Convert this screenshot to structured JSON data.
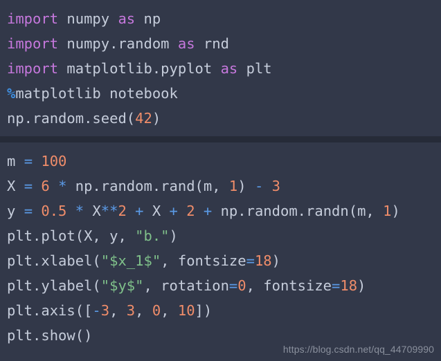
{
  "editor": {
    "theme_name": "dark-notebook",
    "background_color": "#323849",
    "separator_color": "#262b38",
    "default_text_color": "#c6cddb",
    "token_colors": {
      "keyword": "#c678dd",
      "number": "#f08d6a",
      "operator": "#5b9ae6",
      "string": "#7fc08a",
      "magic": "#3f8fe0",
      "name": "#c6cddb"
    }
  },
  "cells": [
    {
      "id": "cell-1",
      "lines": [
        {
          "id": "c1-l1",
          "text": "import numpy as np",
          "tokens": [
            {
              "t": "import",
              "c": "kw"
            },
            {
              "t": " ",
              "c": "punc"
            },
            {
              "t": "numpy",
              "c": "name"
            },
            {
              "t": " ",
              "c": "punc"
            },
            {
              "t": "as",
              "c": "kw"
            },
            {
              "t": " ",
              "c": "punc"
            },
            {
              "t": "np",
              "c": "name"
            }
          ]
        },
        {
          "id": "c1-l2",
          "text": "import numpy.random as rnd",
          "tokens": [
            {
              "t": "import",
              "c": "kw"
            },
            {
              "t": " ",
              "c": "punc"
            },
            {
              "t": "numpy.random",
              "c": "name"
            },
            {
              "t": " ",
              "c": "punc"
            },
            {
              "t": "as",
              "c": "kw"
            },
            {
              "t": " ",
              "c": "punc"
            },
            {
              "t": "rnd",
              "c": "name"
            }
          ]
        },
        {
          "id": "c1-l3",
          "text": "import matplotlib.pyplot as plt",
          "tokens": [
            {
              "t": "import",
              "c": "kw"
            },
            {
              "t": " ",
              "c": "punc"
            },
            {
              "t": "matplotlib.pyplot",
              "c": "name"
            },
            {
              "t": " ",
              "c": "punc"
            },
            {
              "t": "as",
              "c": "kw"
            },
            {
              "t": " ",
              "c": "punc"
            },
            {
              "t": "plt",
              "c": "name"
            }
          ]
        },
        {
          "id": "c1-l4",
          "text": "%matplotlib notebook",
          "tokens": [
            {
              "t": "%",
              "c": "magic"
            },
            {
              "t": "matplotlib notebook",
              "c": "name"
            }
          ]
        },
        {
          "id": "c1-l5",
          "text": "np.random.seed(42)",
          "tokens": [
            {
              "t": "np.random.seed(",
              "c": "name"
            },
            {
              "t": "42",
              "c": "num"
            },
            {
              "t": ")",
              "c": "name"
            }
          ]
        }
      ]
    },
    {
      "id": "cell-2",
      "lines": [
        {
          "id": "c2-l1",
          "text": "m = 100",
          "tokens": [
            {
              "t": "m ",
              "c": "name"
            },
            {
              "t": "=",
              "c": "op"
            },
            {
              "t": " ",
              "c": "punc"
            },
            {
              "t": "100",
              "c": "num"
            }
          ]
        },
        {
          "id": "c2-l2",
          "text": "X = 6 * np.random.rand(m, 1) - 3",
          "tokens": [
            {
              "t": "X ",
              "c": "name"
            },
            {
              "t": "=",
              "c": "op"
            },
            {
              "t": " ",
              "c": "punc"
            },
            {
              "t": "6",
              "c": "num"
            },
            {
              "t": " ",
              "c": "punc"
            },
            {
              "t": "*",
              "c": "op"
            },
            {
              "t": " np.random.rand(m, ",
              "c": "name"
            },
            {
              "t": "1",
              "c": "num"
            },
            {
              "t": ") ",
              "c": "name"
            },
            {
              "t": "-",
              "c": "op"
            },
            {
              "t": " ",
              "c": "punc"
            },
            {
              "t": "3",
              "c": "num"
            }
          ]
        },
        {
          "id": "c2-l3",
          "text": "y = 0.5 * X**2 + X + 2 + np.random.randn(m, 1)",
          "tokens": [
            {
              "t": "y ",
              "c": "name"
            },
            {
              "t": "=",
              "c": "op"
            },
            {
              "t": " ",
              "c": "punc"
            },
            {
              "t": "0.5",
              "c": "num"
            },
            {
              "t": " ",
              "c": "punc"
            },
            {
              "t": "*",
              "c": "op"
            },
            {
              "t": " X",
              "c": "name"
            },
            {
              "t": "**",
              "c": "op"
            },
            {
              "t": "2",
              "c": "num"
            },
            {
              "t": " ",
              "c": "punc"
            },
            {
              "t": "+",
              "c": "op"
            },
            {
              "t": " X ",
              "c": "name"
            },
            {
              "t": "+",
              "c": "op"
            },
            {
              "t": " ",
              "c": "punc"
            },
            {
              "t": "2",
              "c": "num"
            },
            {
              "t": " ",
              "c": "punc"
            },
            {
              "t": "+",
              "c": "op"
            },
            {
              "t": " np.random.randn(m, ",
              "c": "name"
            },
            {
              "t": "1",
              "c": "num"
            },
            {
              "t": ")",
              "c": "name"
            }
          ]
        },
        {
          "id": "c2-l4",
          "text": "plt.plot(X, y, \"b.\")",
          "tokens": [
            {
              "t": "plt.plot(X, y, ",
              "c": "name"
            },
            {
              "t": "\"b.\"",
              "c": "str"
            },
            {
              "t": ")",
              "c": "name"
            }
          ]
        },
        {
          "id": "c2-l5",
          "text": "plt.xlabel(\"$x_1$\", fontsize=18)",
          "tokens": [
            {
              "t": "plt.xlabel(",
              "c": "name"
            },
            {
              "t": "\"$x_1$\"",
              "c": "str"
            },
            {
              "t": ", fontsize",
              "c": "name"
            },
            {
              "t": "=",
              "c": "op"
            },
            {
              "t": "18",
              "c": "num"
            },
            {
              "t": ")",
              "c": "name"
            }
          ]
        },
        {
          "id": "c2-l6",
          "text": "plt.ylabel(\"$y$\", rotation=0, fontsize=18)",
          "tokens": [
            {
              "t": "plt.ylabel(",
              "c": "name"
            },
            {
              "t": "\"$y$\"",
              "c": "str"
            },
            {
              "t": ", rotation",
              "c": "name"
            },
            {
              "t": "=",
              "c": "op"
            },
            {
              "t": "0",
              "c": "num"
            },
            {
              "t": ", fontsize",
              "c": "name"
            },
            {
              "t": "=",
              "c": "op"
            },
            {
              "t": "18",
              "c": "num"
            },
            {
              "t": ")",
              "c": "name"
            }
          ]
        },
        {
          "id": "c2-l7",
          "text": "plt.axis([-3, 3, 0, 10])",
          "tokens": [
            {
              "t": "plt.axis([",
              "c": "name"
            },
            {
              "t": "-",
              "c": "op"
            },
            {
              "t": "3",
              "c": "num"
            },
            {
              "t": ", ",
              "c": "name"
            },
            {
              "t": "3",
              "c": "num"
            },
            {
              "t": ", ",
              "c": "name"
            },
            {
              "t": "0",
              "c": "num"
            },
            {
              "t": ", ",
              "c": "name"
            },
            {
              "t": "10",
              "c": "num"
            },
            {
              "t": "])",
              "c": "name"
            }
          ]
        },
        {
          "id": "c2-l8",
          "text": "plt.show()",
          "tokens": [
            {
              "t": "plt.show()",
              "c": "name"
            }
          ]
        }
      ]
    }
  ],
  "watermark": {
    "text": "https://blog.csdn.net/qq_44709990"
  }
}
